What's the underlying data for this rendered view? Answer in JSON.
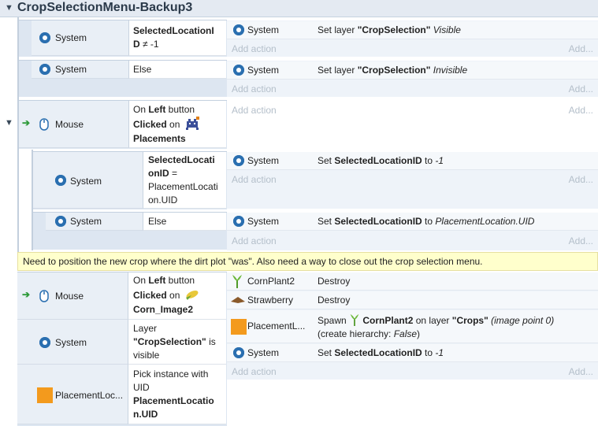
{
  "group": {
    "title": "CropSelectionMenu-Backup3"
  },
  "common": {
    "system": "System",
    "mouse": "Mouse",
    "else": "Else",
    "add_action": "Add action",
    "add_dots": "Add..."
  },
  "ev1": {
    "cond_l1": "SelectedLocationI",
    "cond_l2a": "D",
    "cond_l2b": " ≠ -1",
    "act_set": "Set layer ",
    "act_layer": "\"CropSelection\"",
    "act_state": " Visible"
  },
  "ev2": {
    "act_set": "Set layer ",
    "act_layer": "\"CropSelection\"",
    "act_state": " Invisible"
  },
  "ev3": {
    "on": "On ",
    "left": "Left",
    "button": " button",
    "clicked": "Clicked",
    "on2": " on ",
    "obj": "Placements"
  },
  "ev3a": {
    "cond_l1": "SelectedLocati",
    "cond_l2": "onID",
    "cond_l2b": " =",
    "cond_l3": "PlacementLocati",
    "cond_l4": "on.UID",
    "act_set": "Set ",
    "act_var": "SelectedLocationID",
    "act_to": " to ",
    "act_val": "-1"
  },
  "ev3b": {
    "act_set": "Set ",
    "act_var": "SelectedLocationID",
    "act_to": " to ",
    "act_val": "PlacementLocation.UID"
  },
  "comment": "Need to position the new crop where the dirt plot \"was\".  Also need a way to close out the crop selection menu.",
  "ev4": {
    "c1_on": "On ",
    "c1_left": "Left",
    "c1_button": " button",
    "c1_clicked": "Clicked",
    "c1_on2": " on ",
    "c1_obj": "Corn_Image2",
    "c2_l1": "Layer",
    "c2_l2": "\"CropSelection\"",
    "c2_l2b": " is",
    "c2_l3": "visible",
    "c3_obj": "PlacementLoc...",
    "c3_l1": "Pick instance with",
    "c3_l2": "UID",
    "c3_l3": "PlacementLocatio",
    "c3_l4": "n.UID",
    "a1_obj": "CornPlant2",
    "a1_act": "Destroy",
    "a2_obj": "Strawberry",
    "a2_act": "Destroy",
    "a3_obj": "PlacementL...",
    "a3_spawn": "Spawn ",
    "a3_what": "CornPlant2",
    "a3_onlayer": " on layer ",
    "a3_layer": "\"Crops\"",
    "a3_ip": " (image point 0)",
    "a3_l2a": "(create hierarchy: ",
    "a3_l2b": "False",
    "a3_l2c": ")",
    "a4_set": "Set ",
    "a4_var": "SelectedLocationID",
    "a4_to": " to ",
    "a4_val": "-1"
  }
}
